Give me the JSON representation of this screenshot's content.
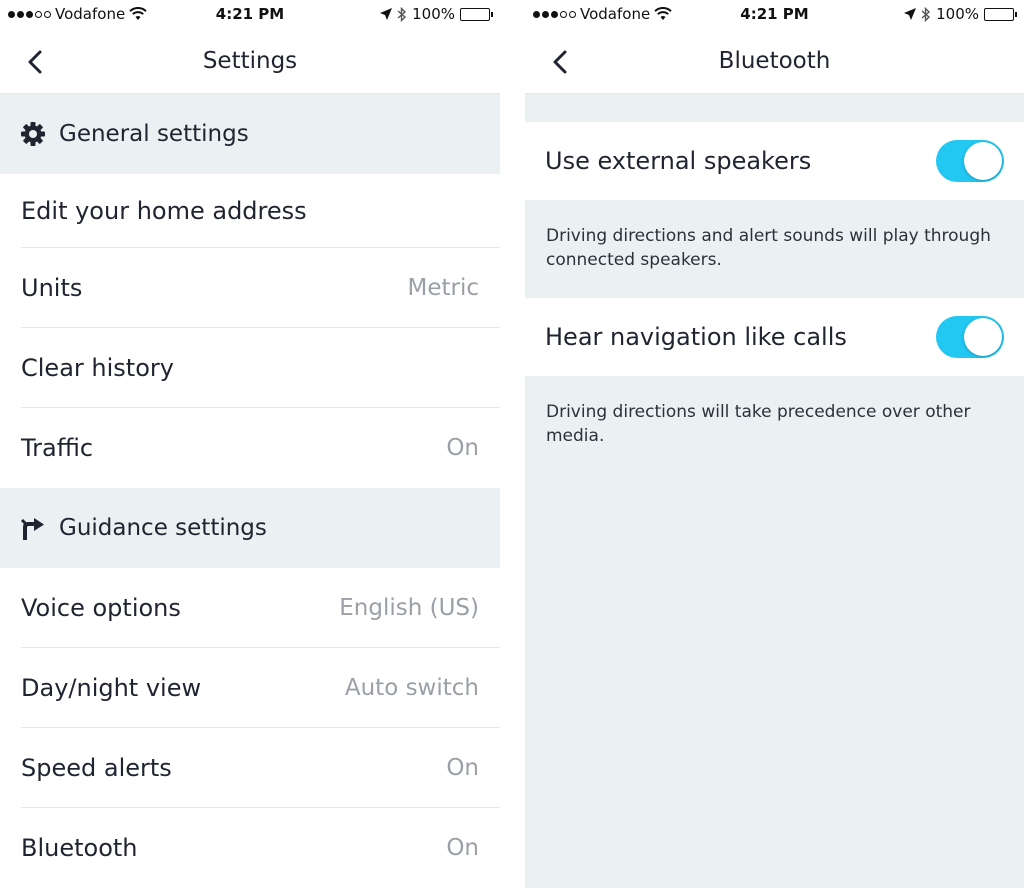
{
  "status_bar": {
    "carrier": "Vodafone",
    "time": "4:21 PM",
    "battery": "100%",
    "signal_bars_filled": 3,
    "signal_bars_total": 5
  },
  "settings_screen": {
    "title": "Settings",
    "general_section": {
      "label": "General settings",
      "icon": "gear-icon"
    },
    "general_items": [
      {
        "label": "Edit your home address",
        "value": ""
      },
      {
        "label": "Units",
        "value": "Metric"
      },
      {
        "label": "Clear history",
        "value": ""
      },
      {
        "label": "Traffic",
        "value": "On"
      }
    ],
    "guidance_section": {
      "label": "Guidance settings",
      "icon": "guidance-arrow-icon"
    },
    "guidance_items": [
      {
        "label": "Voice options",
        "value": "English (US)"
      },
      {
        "label": "Day/night view",
        "value": "Auto switch"
      },
      {
        "label": "Speed alerts",
        "value": "On"
      },
      {
        "label": "Bluetooth",
        "value": "On"
      }
    ]
  },
  "bluetooth_screen": {
    "title": "Bluetooth",
    "toggles": [
      {
        "label": "Use external speakers",
        "enabled": true,
        "description": "Driving directions and alert sounds will play through connected speakers."
      },
      {
        "label": "Hear navigation like calls",
        "enabled": true,
        "description": "Driving directions will take precedence over other media."
      }
    ]
  },
  "colors": {
    "accent": "#22c7f2",
    "section_bg": "#ebf0f3",
    "text_primary": "#1f2430",
    "text_secondary": "#9aa0a6"
  }
}
